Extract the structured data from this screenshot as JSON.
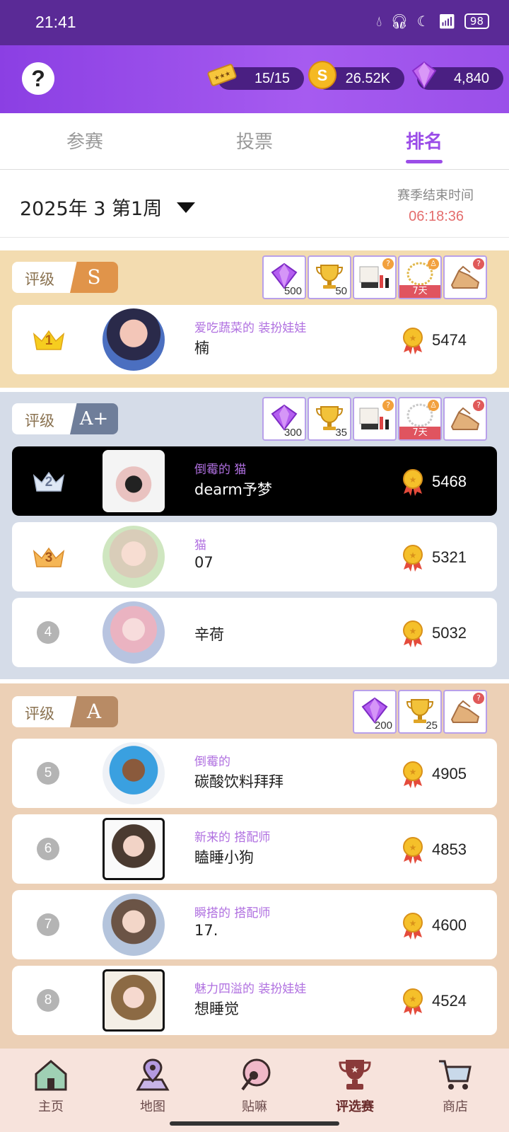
{
  "status_bar": {
    "time": "21:41",
    "battery": "98"
  },
  "header": {
    "help_label": "?",
    "tickets": "15/15",
    "coins": "26.52K",
    "gems": "4,840"
  },
  "tabs": [
    {
      "label": "参赛"
    },
    {
      "label": "投票"
    },
    {
      "label": "排名",
      "active": true
    }
  ],
  "week": {
    "label": "2025年 3 第1周",
    "season_end_label": "赛季结束时间",
    "season_end_time": "06:18:36"
  },
  "sections": [
    {
      "grade_label": "评级",
      "grade": "S",
      "rewards": [
        {
          "item": "gem",
          "qty": "500"
        },
        {
          "item": "trophy",
          "qty": "50"
        },
        {
          "item": "makeup-set",
          "qty": ""
        },
        {
          "item": "necklace",
          "qty": "",
          "tag": "7天"
        },
        {
          "item": "shoes",
          "qty": ""
        }
      ],
      "rows": [
        {
          "rank": "1",
          "subtitle": "爱吃蔬菜的 装扮娃娃",
          "name": "楠",
          "score": "5474"
        }
      ]
    },
    {
      "grade_label": "评级",
      "grade": "A+",
      "rewards": [
        {
          "item": "gem",
          "qty": "300"
        },
        {
          "item": "trophy",
          "qty": "35"
        },
        {
          "item": "makeup-set",
          "qty": ""
        },
        {
          "item": "necklace",
          "qty": "",
          "tag": "7天"
        },
        {
          "item": "shoes",
          "qty": ""
        }
      ],
      "rows": [
        {
          "rank": "2",
          "subtitle": "倒霉的 猫",
          "name": "dearm予梦",
          "score": "5468"
        },
        {
          "rank": "3",
          "subtitle": "猫",
          "name": "07",
          "score": "5321"
        },
        {
          "rank": "4",
          "subtitle": "",
          "name": "辛荷",
          "score": "5032"
        }
      ]
    },
    {
      "grade_label": "评级",
      "grade": "A",
      "rewards": [
        {
          "item": "gem",
          "qty": "200"
        },
        {
          "item": "trophy",
          "qty": "25"
        },
        {
          "item": "shoes",
          "qty": ""
        }
      ],
      "rows": [
        {
          "rank": "5",
          "subtitle": "倒霉的",
          "name": "碳酸饮料拜拜",
          "score": "4905"
        },
        {
          "rank": "6",
          "subtitle": "新来的 搭配师",
          "name": "瞌睡小狗",
          "score": "4853"
        },
        {
          "rank": "7",
          "subtitle": "瞬搭的 搭配师",
          "name": "17.",
          "score": "4600"
        },
        {
          "rank": "8",
          "subtitle": "魅力四溢的 装扮娃娃",
          "name": "想睡觉",
          "score": "4524"
        }
      ]
    }
  ],
  "bottom_nav": [
    {
      "label": "主页",
      "icon": "home-icon"
    },
    {
      "label": "地图",
      "icon": "map-icon"
    },
    {
      "label": "贴嘛",
      "icon": "post-icon"
    },
    {
      "label": "评选赛",
      "icon": "trophy-icon",
      "active": true
    },
    {
      "label": "商店",
      "icon": "cart-icon"
    }
  ],
  "colors": {
    "accent": "#9b4de8",
    "section_s_bg": "#f3dcb0",
    "section_aplus_bg": "#d5dce8",
    "section_a_bg": "#ecd0b6"
  }
}
